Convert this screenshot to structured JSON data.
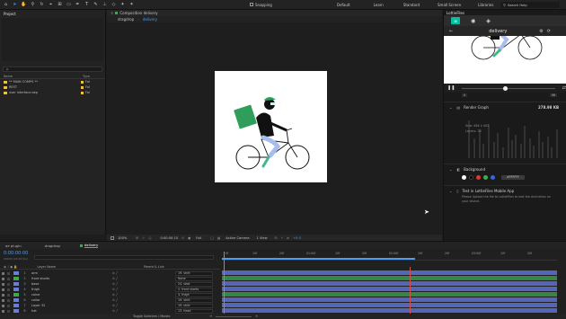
{
  "toolbar": {
    "snapping": "Snapping",
    "workspaces": [
      "Default",
      "Learn",
      "Standard",
      "Small Screen",
      "Libraries"
    ],
    "search_placeholder": "Search Help"
  },
  "project": {
    "title": "Project",
    "search_text": "ρ-",
    "col_name": "Name",
    "col_type": "Type",
    "items": [
      {
        "name": "** MAIN COMPS **",
        "type": "Fol"
      },
      {
        "name": "REST",
        "type": "Fol"
      },
      {
        "name": "user interface.aep",
        "type": "Fol"
      }
    ]
  },
  "viewer": {
    "panel_tab": "Composition delivery",
    "breadcrumbs": [
      "dragdrop",
      "delivery"
    ],
    "bottom": {
      "zoom": "100%",
      "timecode": "0:00:00:10",
      "resolution": "Full",
      "camera": "Active Camera",
      "view": "1 View",
      "offset": "+0.0"
    }
  },
  "lottie": {
    "panel_title": "LottieFiles",
    "comp_name": "delivery",
    "timeline_start": "0",
    "timeline_end": "96",
    "render_graph_title": "Render Graph",
    "render_graph_size": "278.98 KB",
    "size_label": "Size: 464 x 402",
    "layers_label": "Layers: 30",
    "background_title": "Background",
    "hex_value": "#FFFFFF",
    "mobile_title": "Test in LottieFiles Mobile App",
    "mobile_desc": "Please Upload the file to LottieFiles to test the Animation on your device.",
    "swatches": [
      "#ffffff",
      "#000000",
      "#e0392b",
      "#3fae49",
      "#3766d6"
    ]
  },
  "timeline": {
    "tabs": [
      "ae plugin",
      "dragdrop",
      "delivery"
    ],
    "timecode": "0:00:00:00",
    "fps": "00000 (24.00 fps)",
    "col_layer_name": "Layer Name",
    "col_parent": "Parent & Link",
    "footer": "Toggle Switches / Modes",
    "ruler": [
      "0f",
      "10f",
      "20f",
      "01:00f",
      "10f",
      "20f",
      "02:00f",
      "10f",
      "20f",
      "03:00f",
      "10f",
      "20f"
    ],
    "layers": [
      {
        "n": "1",
        "name": "arm",
        "parent": "19. shirt",
        "color": "#6a7dd8"
      },
      {
        "n": "2",
        "name": "front shorts",
        "parent": "None",
        "color": "#3ea84d"
      },
      {
        "n": "3",
        "name": "base",
        "parent": "24. seat",
        "color": "#6a7dd8"
      },
      {
        "n": "4",
        "name": "thigh",
        "parent": "2. front shorts",
        "color": "#6a7dd8"
      },
      {
        "n": "5",
        "name": "calve",
        "parent": "4. thigh",
        "color": "#3ea84d"
      },
      {
        "n": "6",
        "name": "collar",
        "parent": "19. shirt",
        "color": "#6a7dd8"
      },
      {
        "n": "7",
        "name": "Layer 32",
        "parent": "19. shirt",
        "color": "#6a7dd8"
      },
      {
        "n": "8",
        "name": "hat",
        "parent": "13. head",
        "color": "#6a7dd8"
      }
    ]
  }
}
